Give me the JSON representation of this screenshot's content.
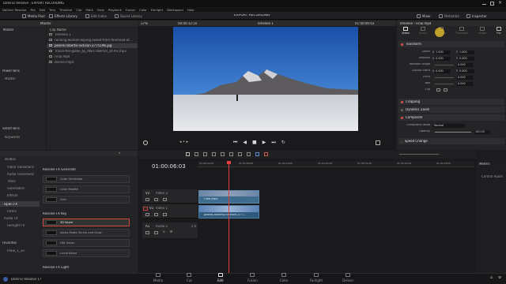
{
  "app": {
    "title_bar": "DaVinci Resolve - EXPORT RECORDING",
    "menu": [
      "DaVinci Resolve",
      "File",
      "Edit",
      "Trim",
      "Timeline",
      "Clip",
      "Mark",
      "View",
      "Playback",
      "Fusion",
      "Color",
      "Fairlight",
      "Workspace",
      "Help"
    ],
    "project_title": "EXPORT RECORDING",
    "footer_app": "DaVinci Resolve 17"
  },
  "toolbar": {
    "media_pool": "Media Pool",
    "effects_library": "Effects Library",
    "edit_index": "Edit Index",
    "sound_library": "Sound Library",
    "mixer": "Mixer",
    "metadata": "Metadata",
    "inspector": "Inspector"
  },
  "media_pool": {
    "bin_label": "Master",
    "zoom": "37%",
    "timecode": "00:00:12:10",
    "column_header": "Clip Name",
    "clips": [
      "Timeline 1",
      "running-woman-wiping-sweat-from-forehead-at...",
      "pexels-roberto-nickson-2775196.jpg",
      "Travel-the-globe_by_Marc-Vollmer_at-Pix.mp3",
      "Final.mp4",
      "Deliver.mp4"
    ],
    "selected_index": 2,
    "master_side": "Master",
    "power_bins": "Power Bins",
    "power_master": "Master",
    "smart_bins": "Smart Bins",
    "keywords": "Keywords"
  },
  "viewer": {
    "timeline_name": "Timeline 1",
    "timecode_right": "01:00:06:03"
  },
  "inspector": {
    "clip_title": "Timeline - Final.mp4",
    "tabs": [
      "Video",
      "Audio",
      "Effects",
      "Transition",
      "Image",
      "File"
    ],
    "active_tab": "Video",
    "sections": {
      "transform": "Transform",
      "cropping": "Cropping",
      "dynamic_zoom": "Dynamic Zoom",
      "composite": "Composite",
      "speed_change": "Speed Change"
    },
    "rows": [
      {
        "label": "Zoom",
        "x_label": "X",
        "x": "1.000",
        "y_label": "Y",
        "y": "1.000"
      },
      {
        "label": "Position",
        "x_label": "X",
        "x": "0.000",
        "y_label": "Y",
        "y": "0.000"
      },
      {
        "label": "Rotation Angle",
        "x": "0.000"
      },
      {
        "label": "Anchor Point",
        "x_label": "X",
        "x": "0.000",
        "y_label": "Y",
        "y": "0.000"
      },
      {
        "label": "Pitch",
        "x": "0.000"
      },
      {
        "label": "Yaw",
        "x": "0.000"
      },
      {
        "label": "Flip",
        "x": ""
      }
    ],
    "composite_mode_label": "Composite Mode",
    "composite_mode": "Normal",
    "opacity_label": "Opacity",
    "opacity": "100.00"
  },
  "effects": {
    "tree": [
      "Toolbox",
      "Video Transitions",
      "Audio Transitions",
      "Titles",
      "Generators",
      "Effects",
      "Open FX",
      "Filters",
      "Audio FX",
      "Fairlight FX"
    ],
    "active_tree": "Open FX",
    "favorites_label": "Favorites",
    "favorite_item": "FREE_1_33",
    "group1": "Resolve FX Generate",
    "group1_items": [
      "Color Generator",
      "Color Palette",
      "Grid"
    ],
    "group2": "Resolve FX Key",
    "group2_items": [
      "3D Keyer",
      "Alpha Matte Shrink and Grow",
      "HSL Keyer",
      "Luma Keyer"
    ],
    "selected_fx": "3D Keyer",
    "group3": "Resolve FX Light"
  },
  "timeline": {
    "timecode": "01:00:06:03",
    "ruler_labels": [
      "01:00:00:00",
      "01:00:08:00",
      "01:00:16:00",
      "01:00:24:00",
      "01:00:32:00",
      "01:00:40:00",
      "01:00:48:00"
    ],
    "tracks": [
      {
        "id": "V2",
        "name": "Video 2",
        "clip": "Final.mp4"
      },
      {
        "id": "V1",
        "name": "Video 1",
        "clip": "pexels-roberto-nickson-277..."
      },
      {
        "id": "A1",
        "name": "Audio 1",
        "level": "2.0"
      }
    ],
    "meters_label": "Meters",
    "control_room": "Control Room"
  },
  "pages": [
    "Media",
    "Cut",
    "Edit",
    "Fusion",
    "Color",
    "Fairlight",
    "Deliver"
  ],
  "active_page": "Edit"
}
